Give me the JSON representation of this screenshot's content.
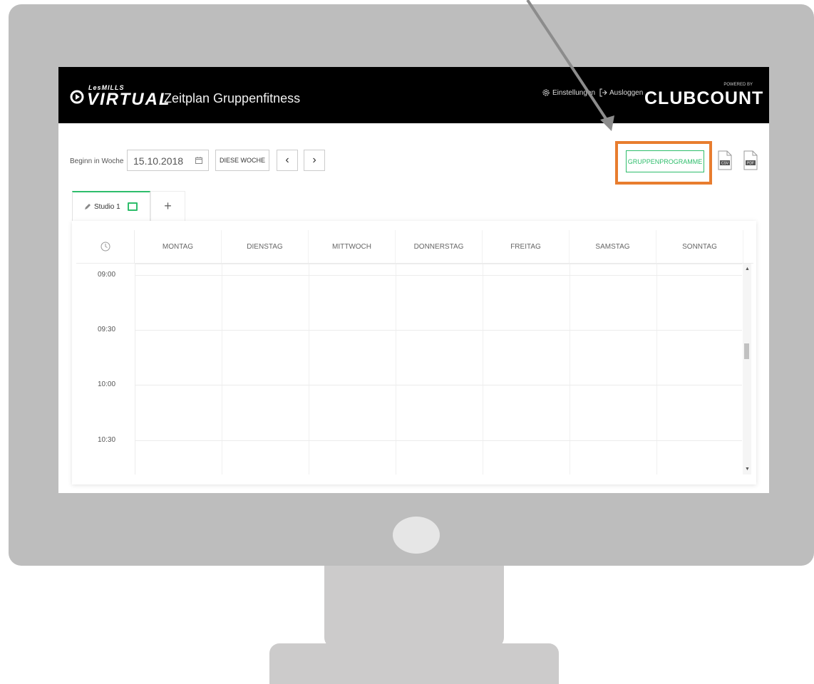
{
  "header": {
    "logo_small": "LesMILLS",
    "logo_big": "VIRTUAL",
    "title": "Zeitplan Gruppenfitness",
    "settings_label": "Einstellungen",
    "logout_label": "Ausloggen",
    "brand_small": "POWERED BY",
    "brand_big": "CLUBCOUNT"
  },
  "toolbar": {
    "week_label": "Beginn in Woche",
    "date_value": "15.10.2018",
    "this_week_label": "DIESE WOCHE",
    "prev_label": "‹",
    "next_label": "›",
    "group_programs_label": "GRUPPENPROGRAMME",
    "csv_label": "CSV",
    "pdf_label": "PDF"
  },
  "tabs": {
    "studio_label": "Studio 1",
    "add_label": "+"
  },
  "calendar": {
    "days": [
      "MONTAG",
      "DIENSTAG",
      "MITTWOCH",
      "DONNERSTAG",
      "FREITAG",
      "SAMSTAG",
      "SONNTAG"
    ],
    "times": [
      "09:00",
      "09:30",
      "10:00",
      "10:30"
    ]
  },
  "colors": {
    "accent": "#2ebd6b",
    "highlight": "#e87d2f",
    "topbar": "#000000",
    "monitor": "#bdbdbd"
  },
  "icons": [
    "play-icon",
    "gear-icon",
    "logout-icon",
    "calendar-icon",
    "csv-file-icon",
    "pdf-file-icon",
    "pencil-icon",
    "studio-color-icon",
    "clock-icon",
    "arrow-pointer"
  ]
}
